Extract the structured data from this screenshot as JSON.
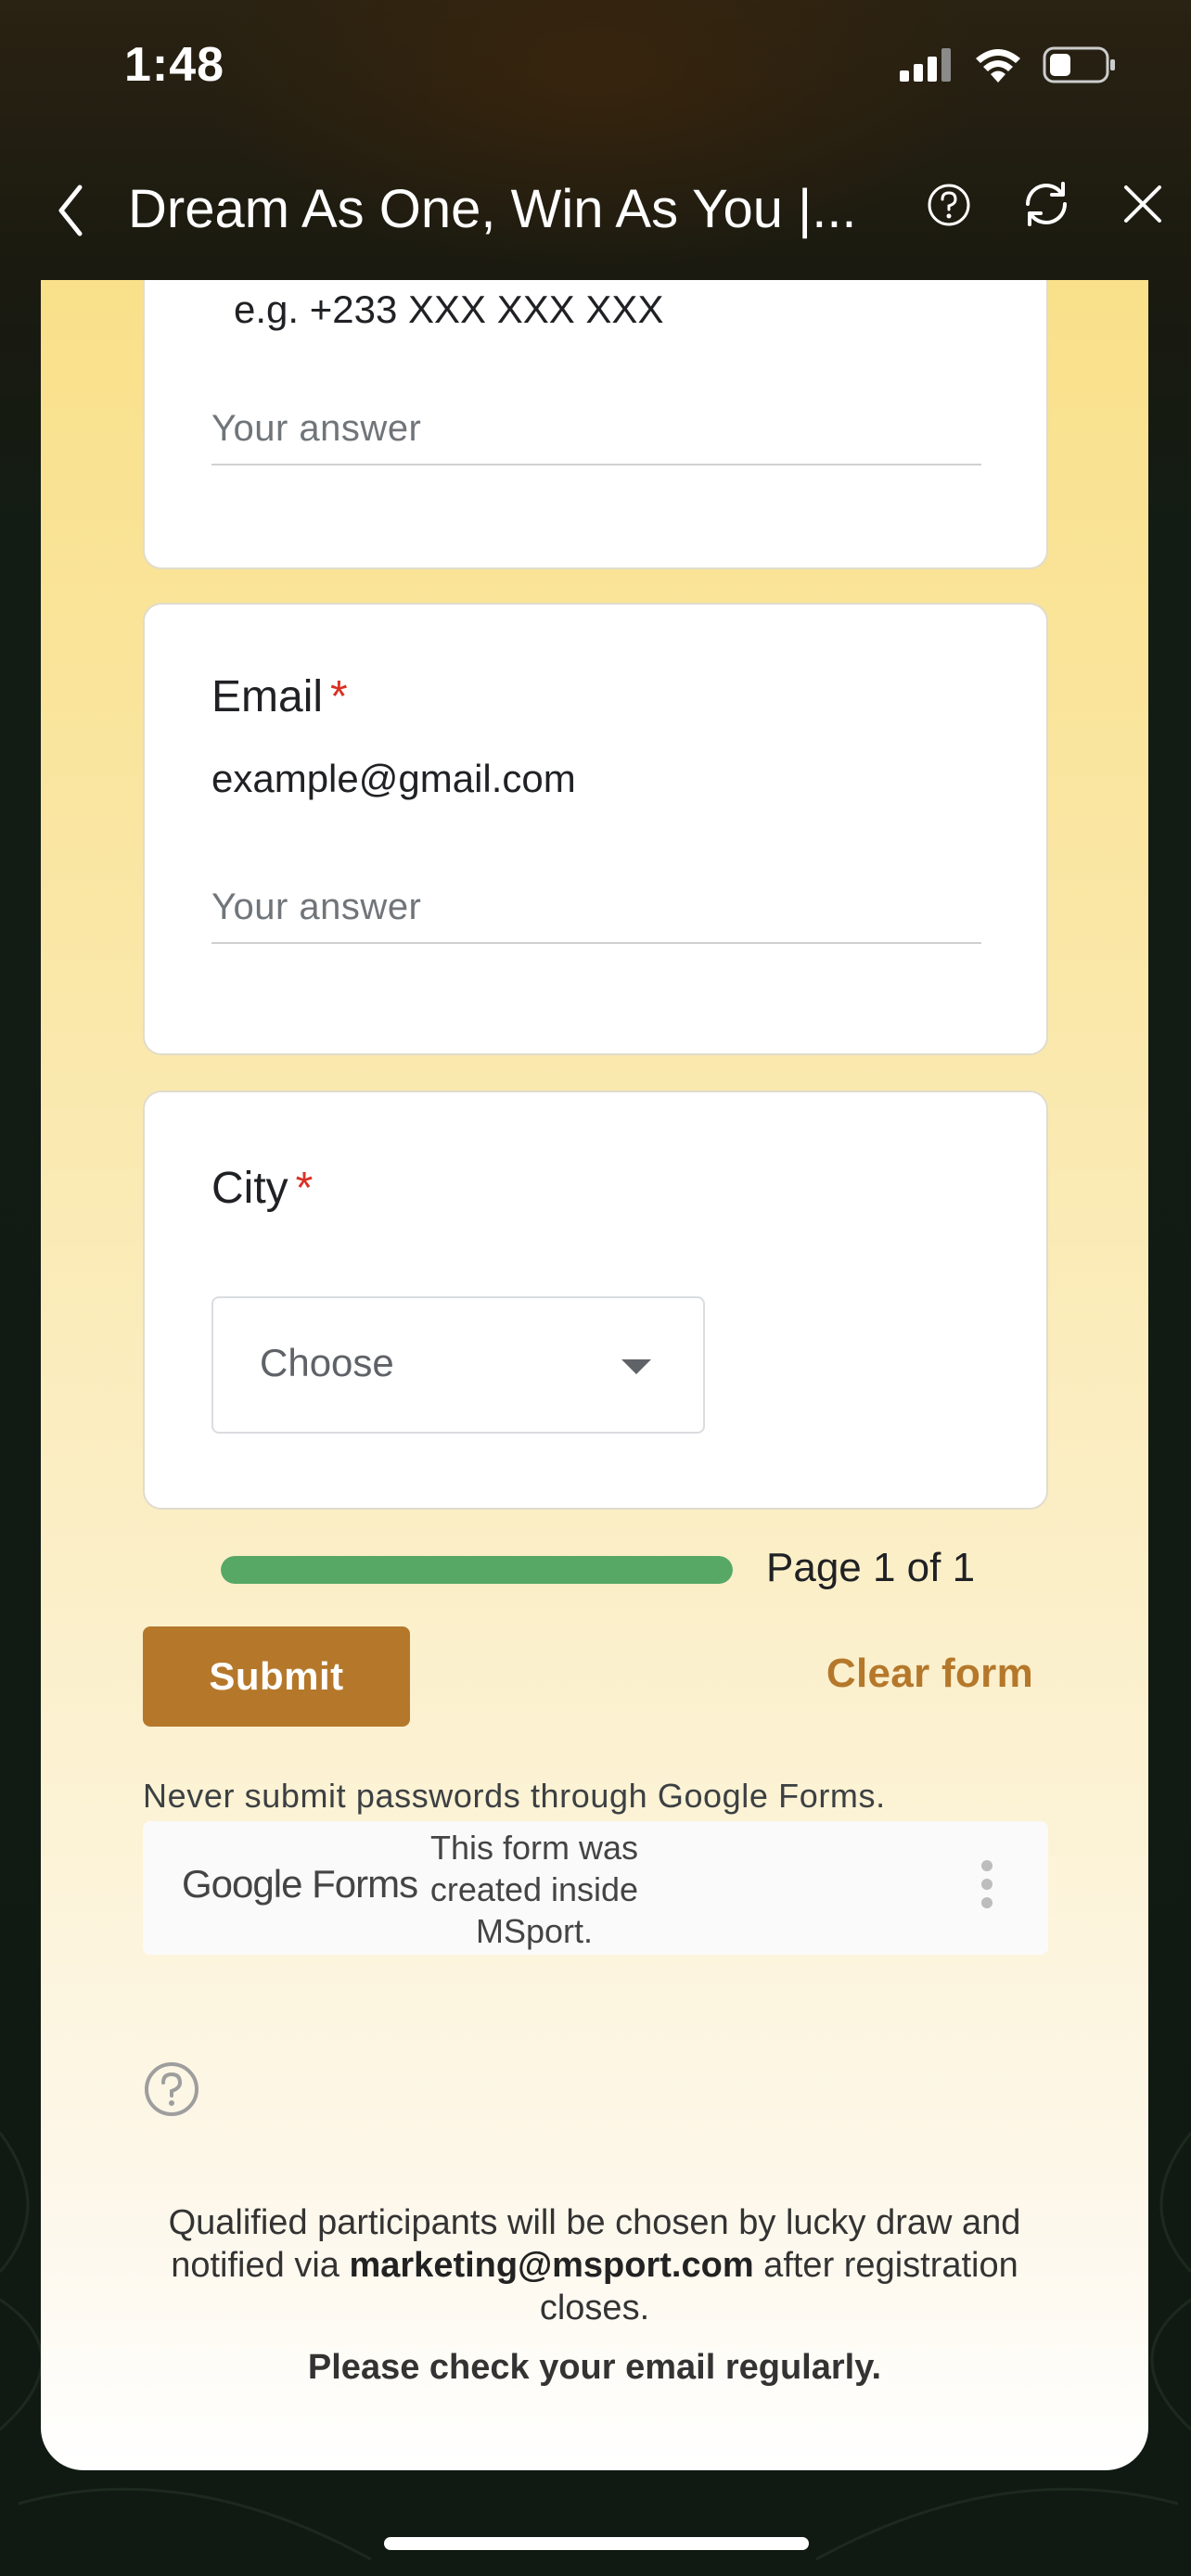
{
  "status_bar": {
    "time": "1:48"
  },
  "nav": {
    "title": "Dream As One, Win As You |..."
  },
  "form": {
    "phone_card": {
      "hint": "e.g. +233 XXX XXX XXX",
      "answer_placeholder": "Your answer"
    },
    "email_card": {
      "label": "Email",
      "required_mark": "*",
      "description": "example@gmail.com",
      "answer_placeholder": "Your answer"
    },
    "city_card": {
      "label": "City",
      "required_mark": "*",
      "dropdown_value": "Choose"
    },
    "progress": {
      "text": "Page 1 of 1",
      "fraction": 1.0
    },
    "submit_label": "Submit",
    "clear_label": "Clear form",
    "warning": "Never submit passwords through Google Forms.",
    "footer": {
      "logo_google": "Google",
      "logo_forms": "Forms",
      "created_text": "This form was created inside MSport."
    }
  },
  "disclaimer": {
    "line_before": "Qualified participants will be chosen by lucky draw and notified via ",
    "email": "marketing@msport.com",
    "line_after": " after registration closes.",
    "check": "Please check your email regularly."
  },
  "colors": {
    "accent": "#b5782b",
    "progress": "#57a865",
    "required": "#d93025"
  }
}
